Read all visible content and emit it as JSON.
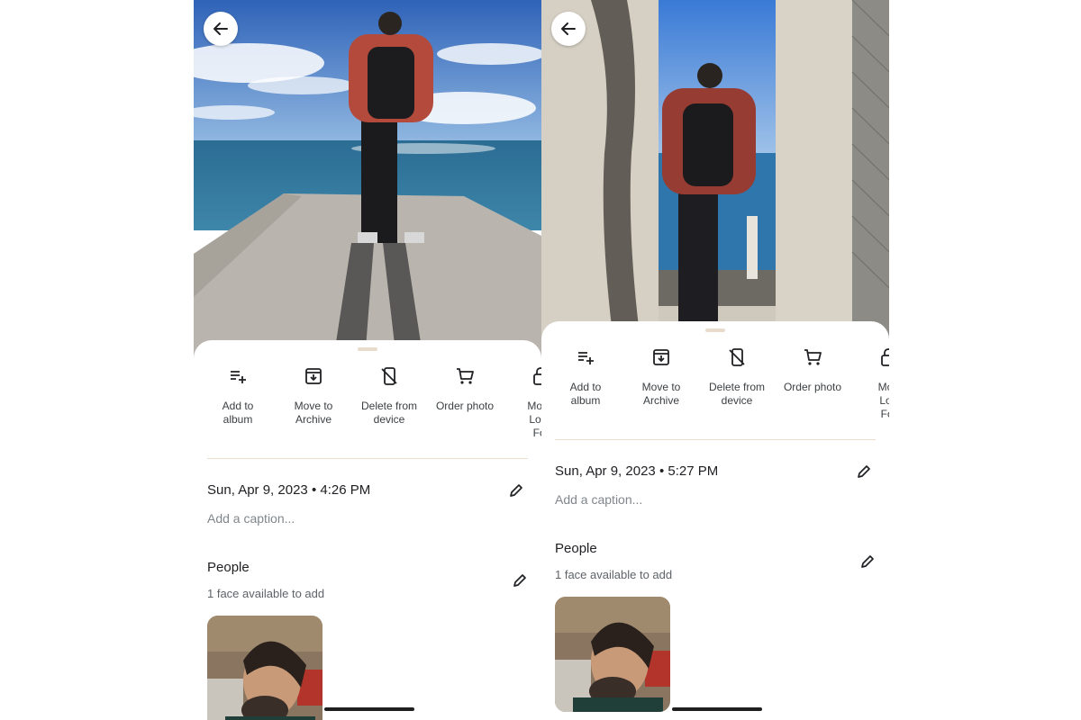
{
  "screens": [
    {
      "actions": [
        {
          "label": "Add to\nalbum",
          "icon": "playlist-add-icon"
        },
        {
          "label": "Move to\nArchive",
          "icon": "archive-icon"
        },
        {
          "label": "Delete from\ndevice",
          "icon": "delete-from-device-icon"
        },
        {
          "label": "Order photo",
          "icon": "cart-icon"
        },
        {
          "label": "Move\nLock\nFol",
          "icon": "lock-icon"
        }
      ],
      "date": "Sun, Apr 9, 2023",
      "time": "4:26 PM",
      "caption_placeholder": "Add a caption...",
      "people_title": "People",
      "faces_text": "1 face available to add"
    },
    {
      "actions": [
        {
          "label": "Add to\nalbum",
          "icon": "playlist-add-icon"
        },
        {
          "label": "Move to\nArchive",
          "icon": "archive-icon"
        },
        {
          "label": "Delete from\ndevice",
          "icon": "delete-from-device-icon"
        },
        {
          "label": "Order photo",
          "icon": "cart-icon"
        },
        {
          "label": "Mov\nLoc\nFol",
          "icon": "lock-icon"
        }
      ],
      "date": "Sun, Apr 9, 2023",
      "time": "5:27 PM",
      "caption_placeholder": "Add a caption...",
      "people_title": "People",
      "faces_text": "1 face available to add"
    }
  ],
  "colors": {
    "accent_divider": "#eadfce",
    "sky": "#3f79c8",
    "sea": "#2f6f96",
    "jacket": "#b44a3c"
  }
}
